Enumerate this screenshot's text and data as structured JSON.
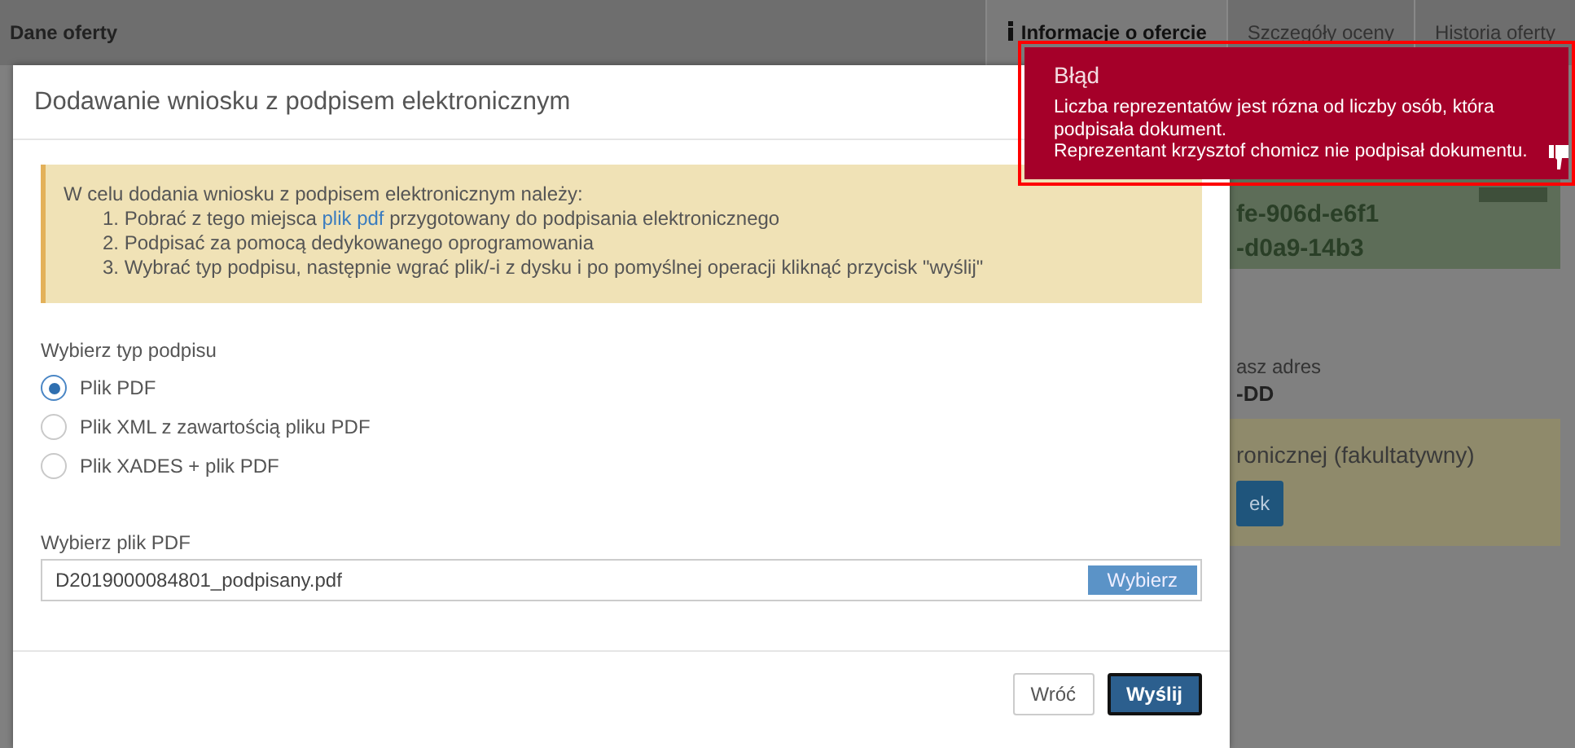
{
  "page_header": {
    "title": "Dane oferty",
    "tabs": [
      {
        "label": "Informacje o ofercie",
        "selected": true
      },
      {
        "label": "Szczegóły oceny",
        "selected": false
      },
      {
        "label": "Historia oferty",
        "selected": false
      }
    ]
  },
  "offer_card": {
    "lines": [
      "fe-906d-e6f1",
      "-d0a9-14b3"
    ]
  },
  "address": {
    "label": "asz adres",
    "value": "-DD"
  },
  "optional_panel": {
    "title": "ronicznej (fakultatywny)",
    "button": "ek"
  },
  "dialog": {
    "title": "Dodawanie wniosku z podpisem elektronicznym",
    "instructions": {
      "intro": "W celu dodania wniosku z podpisem elektronicznym należy:",
      "steps": [
        {
          "number": "1.",
          "text": "Pobrać z tego miejsca ",
          "link": "plik pdf",
          "text_after": " przygotowany do podpisania elektronicznego"
        },
        {
          "number": "2.",
          "text": "Podpisać za pomocą dedykowanego oprogramowania"
        },
        {
          "number": "3.",
          "text": "Wybrać typ podpisu, następnie wgrać plik/-i z dysku i po pomyślnej operacji kliknąć przycisk \"wyślij\""
        }
      ]
    },
    "signature_type": {
      "label": "Wybierz typ podpisu",
      "options": [
        {
          "label": "Plik PDF",
          "selected": true
        },
        {
          "label": "Plik XML z zawartością pliku PDF",
          "selected": false
        },
        {
          "label": "Plik XADES + plik PDF",
          "selected": false
        }
      ]
    },
    "file": {
      "label": "Wybierz plik PDF",
      "value": "D2019000084801_podpisany.pdf",
      "button": "Wybierz"
    },
    "buttons": [
      {
        "label": "Wróć",
        "kind": "secondary"
      },
      {
        "label": "Wyślij",
        "kind": "primary"
      }
    ]
  },
  "error_toast": {
    "title": "Błąd",
    "messages": [
      "Liczba reprezentatów jest rózna od liczby osób, która podpisała dokument.",
      "Reprezentant krzysztof chomicz nie podpisał dokumentu."
    ]
  }
}
